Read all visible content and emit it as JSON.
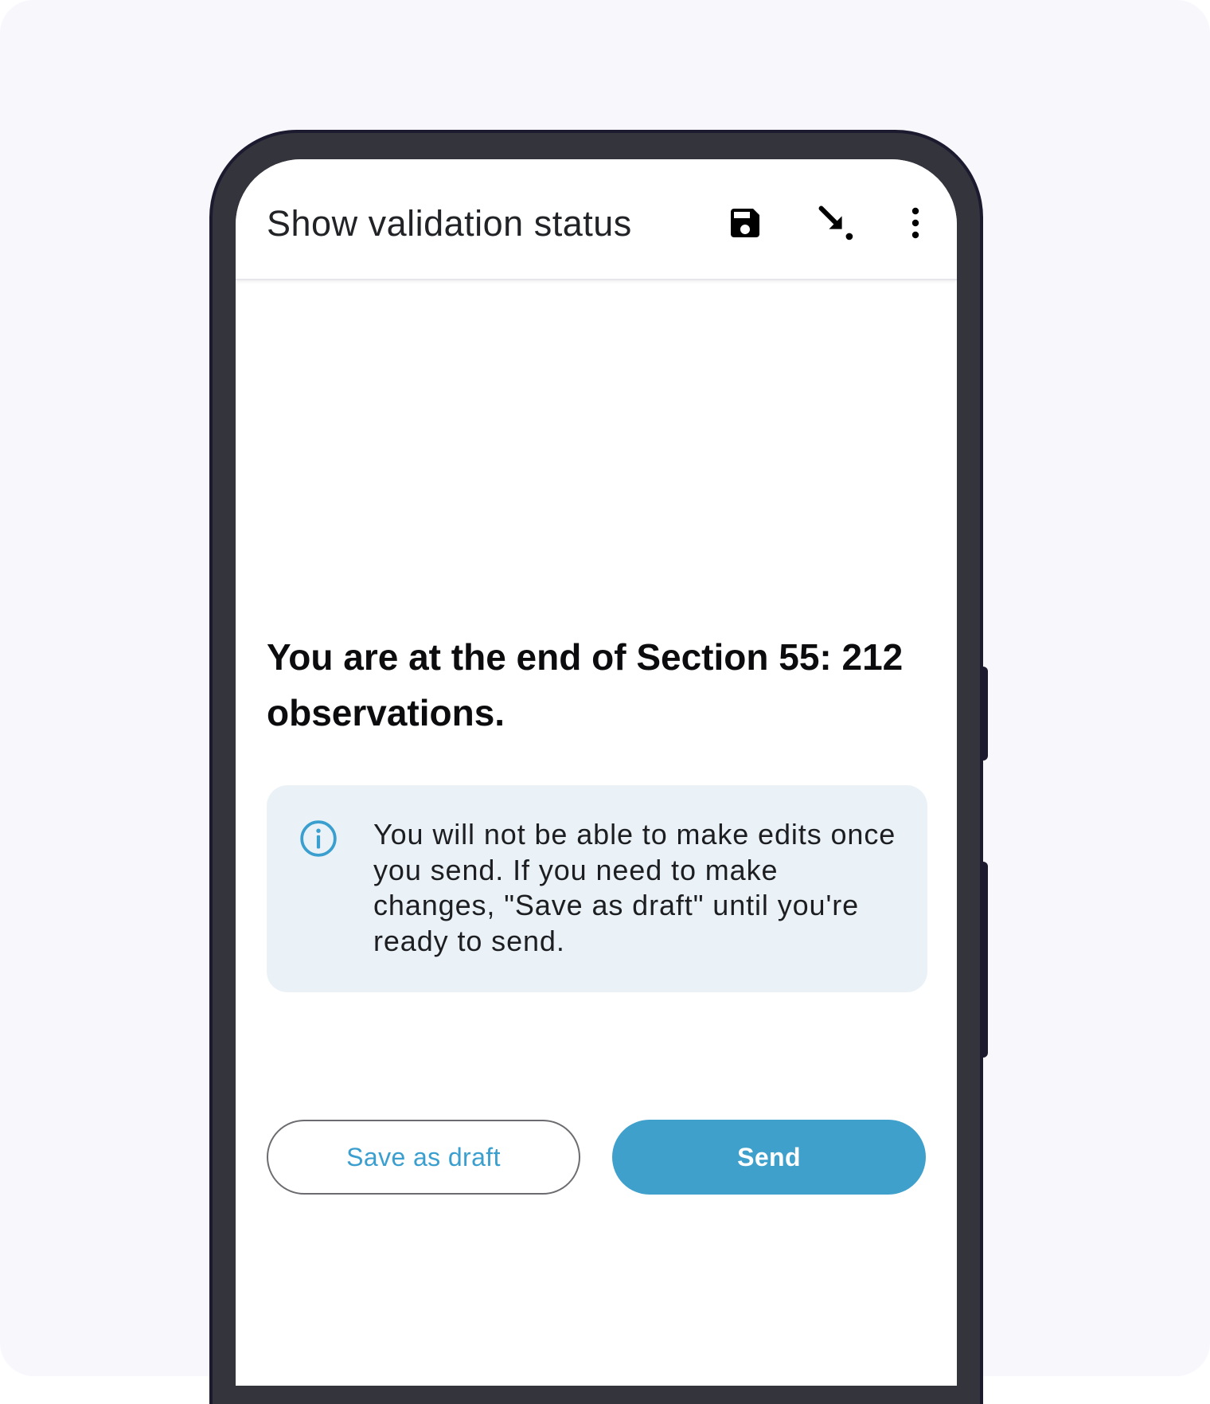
{
  "app_bar": {
    "title": "Show validation status",
    "icons": {
      "save": "save-icon",
      "download": "download-arrow-icon",
      "more": "more-vertical-icon"
    }
  },
  "main": {
    "heading": "You are at the end of Section 55: 212 observations.",
    "info_message": "You will not be able to make edits once you send. If you need to make changes, \"Save as draft\" until you're ready to send.",
    "save_draft_label": "Save as draft",
    "send_label": "Send"
  },
  "colors": {
    "accent": "#3fa0cc",
    "info_background": "#eaf2f7",
    "phone_frame": "#34343d"
  }
}
